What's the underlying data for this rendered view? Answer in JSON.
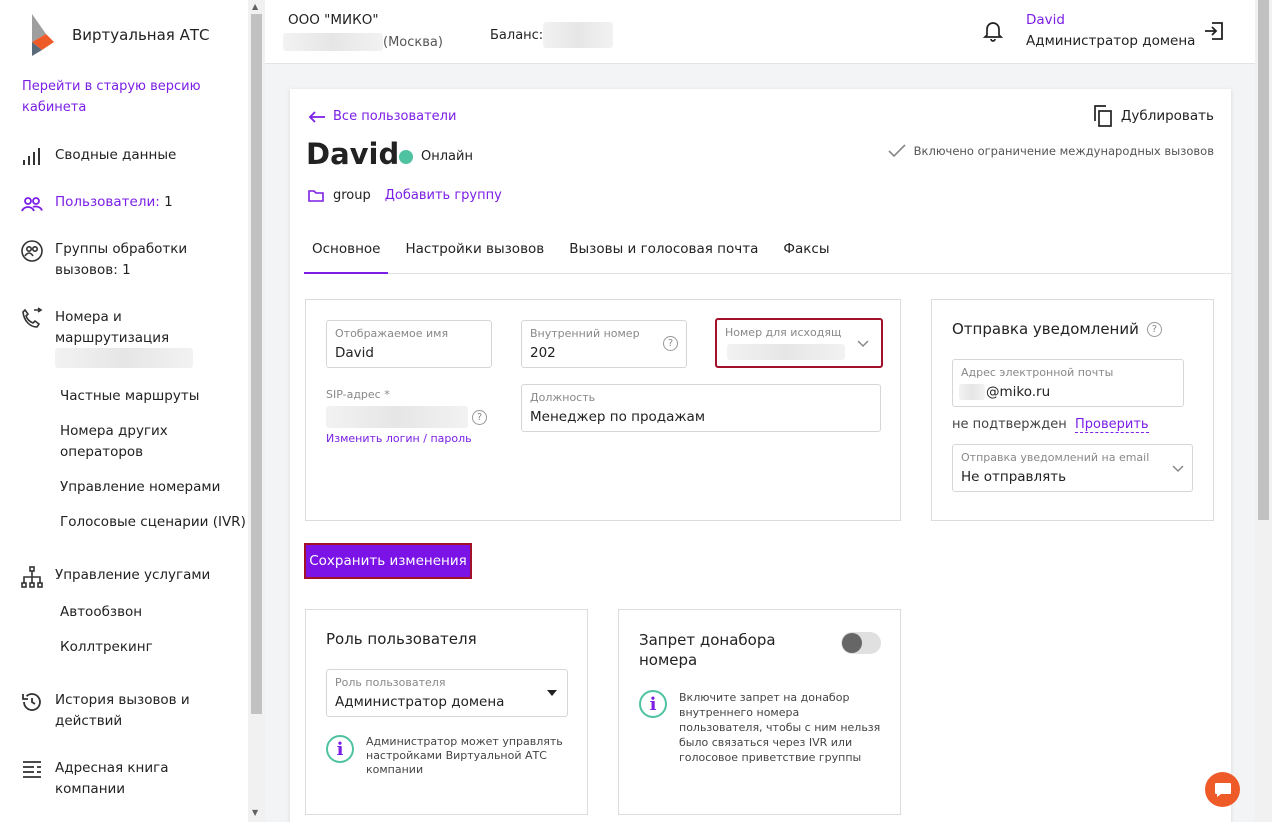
{
  "sidebar": {
    "logo_title": "Виртуальная АТС",
    "old_version_link": "Перейти в старую версию кабинета",
    "nav": [
      {
        "label": "Сводные данные"
      },
      {
        "label": "Пользователи:",
        "count": "1"
      },
      {
        "label": "Группы обработки вызовов:",
        "count": "1"
      },
      {
        "label": "Номера и маршрутизация"
      },
      {
        "label": "Управление услугами"
      },
      {
        "label": "История вызовов и действий"
      },
      {
        "label": "Адресная книга компании"
      }
    ],
    "numbers_sub": [
      "Частные маршруты",
      "Номера других операторов",
      "Управление номерами",
      "Голосовые сценарии (IVR)"
    ],
    "services_sub": [
      "Автообзвон",
      "Коллтрекинг"
    ]
  },
  "topbar": {
    "company": "ООО \"МИКО\"",
    "city": "(Москва)",
    "balance_label": "Баланс:",
    "user_name": "David",
    "user_role": "Администратор домена"
  },
  "card": {
    "back_link": "Все пользователи",
    "duplicate": "Дублировать",
    "user_title": "David",
    "status": "Онлайн",
    "intl_restriction": "Включено ограничение международных вызовов",
    "group_name": "group",
    "add_group": "Добавить группу",
    "tabs": [
      "Основное",
      "Настройки вызовов",
      "Вызовы и голосовая почта",
      "Факсы"
    ],
    "fields": {
      "display_name_label": "Отображаемое имя",
      "display_name": "David",
      "ext_label": "Внутренний номер",
      "ext": "202",
      "outgoing_label": "Номер для исходящ",
      "sip_label": "SIP-адрес *",
      "change_login": "Изменить логин / пароль",
      "position_label": "Должность",
      "position": "Менеджер по продажам"
    },
    "notify": {
      "title": "Отправка уведомлений",
      "email_label": "Адрес электронной почты",
      "email": "@miko.ru",
      "not_confirmed": "не подтвержден",
      "check": "Проверить",
      "send_label": "Отправка уведомлений на email",
      "send_value": "Не отправлять"
    },
    "save_button": "Сохранить изменения",
    "role": {
      "title": "Роль пользователя",
      "field_label": "Роль пользователя",
      "field_value": "Администратор домена",
      "info": "Администратор может управлять настройками Виртуальной АТС компании"
    },
    "donabor": {
      "title": "Запрет донабора номера",
      "info": "Включите запрет на донабор внутреннего номера пользователя, чтобы с ним нельзя было связаться через IVR или голосовое приветствие группы"
    }
  },
  "colors": {
    "accent": "#7b1fe6",
    "online": "#4fc3a1",
    "chat": "#ef5b28",
    "highlight": "#a3102a"
  }
}
